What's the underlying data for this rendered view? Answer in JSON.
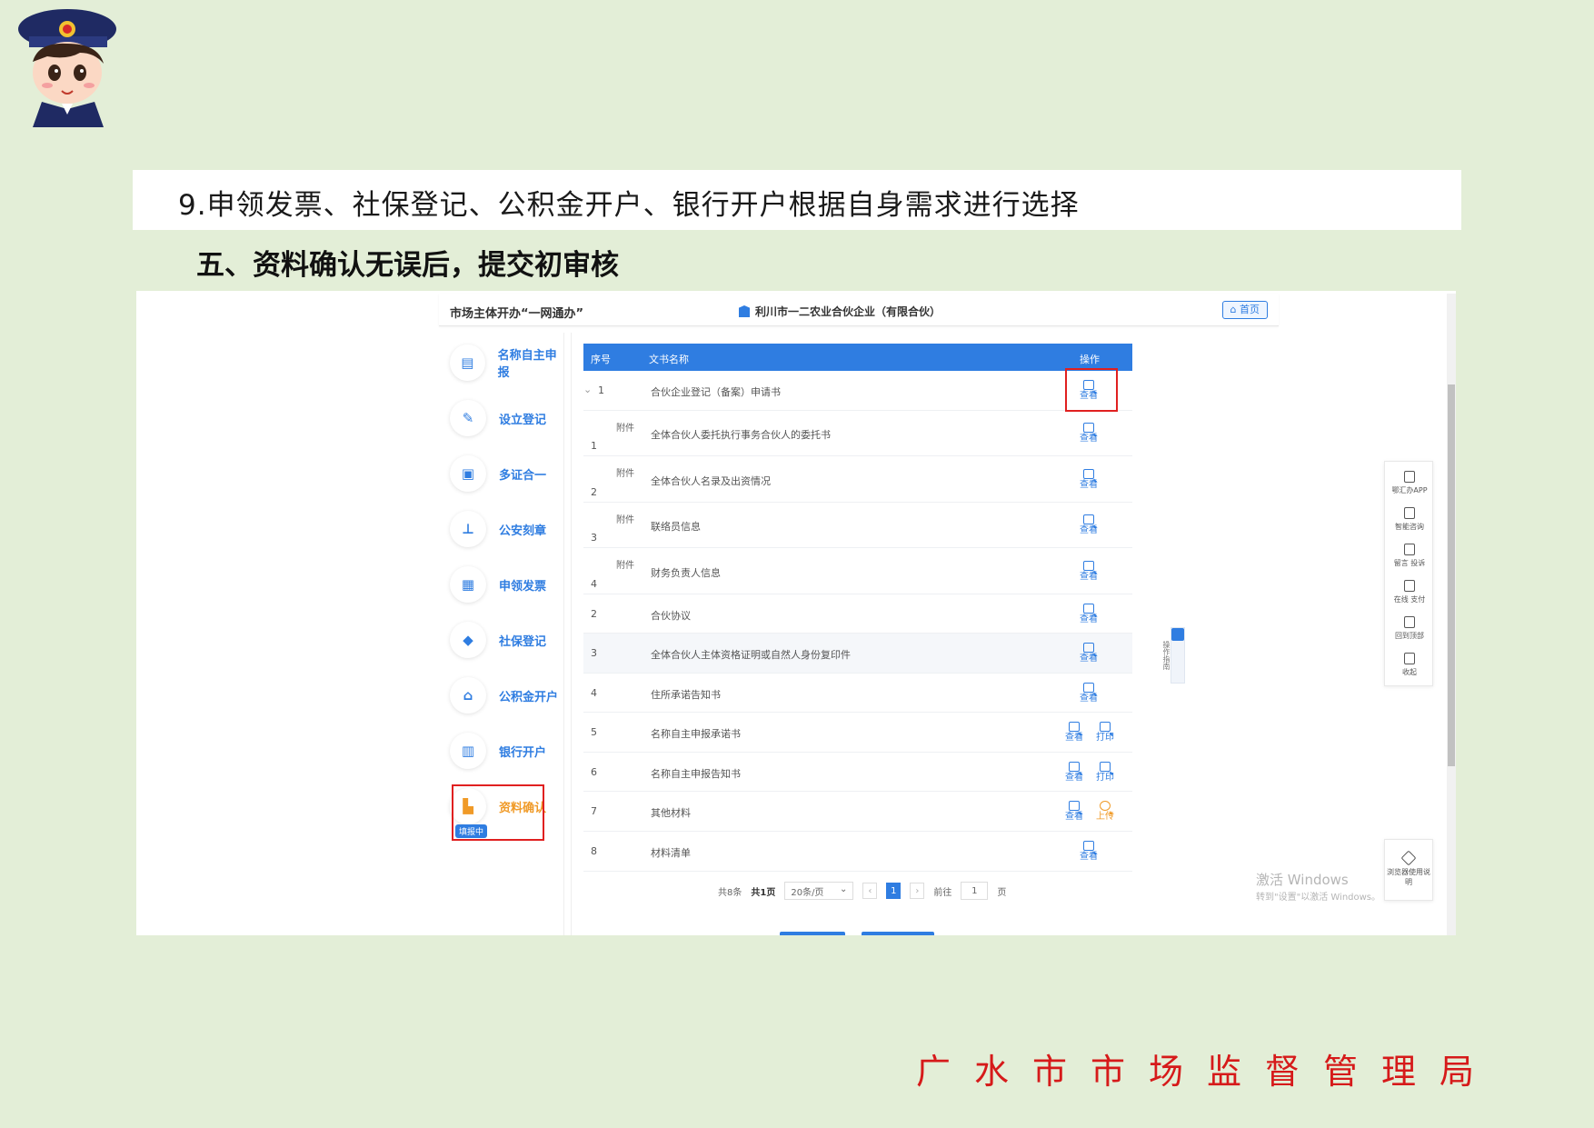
{
  "doc": {
    "step_text": "9.申领发票、社保登记、公积金开户、银行开户根据自身需求进行选择",
    "section_title": "五、资料确认无误后，提交初审核",
    "footer_org": "广水市市场监督管理局"
  },
  "app": {
    "title": "市场主体开办“一网通办”",
    "company": "利川市一二农业合伙企业（有限合伙）",
    "home_label": "首页"
  },
  "sidebar": {
    "items": [
      {
        "label": "名称自主申报",
        "icon": "doc-icon"
      },
      {
        "label": "设立登记",
        "icon": "edit-icon"
      },
      {
        "label": "多证合一",
        "icon": "id-card-icon"
      },
      {
        "label": "公安刻章",
        "icon": "stamp-icon"
      },
      {
        "label": "申领发票",
        "icon": "invoice-icon"
      },
      {
        "label": "社保登记",
        "icon": "shield-icon"
      },
      {
        "label": "公积金开户",
        "icon": "house-icon"
      },
      {
        "label": "银行开户",
        "icon": "bank-icon"
      },
      {
        "label": "资料确认",
        "icon": "file-icon"
      }
    ],
    "active_index": 8,
    "progress_badge": "填报中"
  },
  "table": {
    "headers": {
      "seq": "序号",
      "name": "文书名称",
      "ops": "操作"
    },
    "rows": [
      {
        "seq": "1",
        "expander": "⌄",
        "attach": "",
        "name": "合伙企业登记（备案）申请书",
        "ops": [
          "查看"
        ]
      },
      {
        "seq": "1",
        "attach": "附件",
        "name": "全体合伙人委托执行事务合伙人的委托书",
        "ops": [
          "查看"
        ]
      },
      {
        "seq": "2",
        "attach": "附件",
        "name": "全体合伙人名录及出资情况",
        "ops": [
          "查看"
        ]
      },
      {
        "seq": "3",
        "attach": "附件",
        "name": "联络员信息",
        "ops": [
          "查看"
        ]
      },
      {
        "seq": "4",
        "attach": "附件",
        "name": "财务负责人信息",
        "ops": [
          "查看"
        ]
      },
      {
        "seq": "2",
        "attach": "",
        "name": "合伙协议",
        "ops": [
          "查看"
        ]
      },
      {
        "seq": "3",
        "attach": "",
        "name": "全体合伙人主体资格证明或自然人身份复印件",
        "ops": [
          "查看"
        ]
      },
      {
        "seq": "4",
        "attach": "",
        "name": "住所承诺告知书",
        "ops": [
          "查看"
        ]
      },
      {
        "seq": "5",
        "attach": "",
        "name": "名称自主申报承诺书",
        "ops": [
          "查看",
          "打印"
        ]
      },
      {
        "seq": "6",
        "attach": "",
        "name": "名称自主申报告知书",
        "ops": [
          "查看",
          "打印"
        ]
      },
      {
        "seq": "7",
        "attach": "",
        "name": "其他材料",
        "ops": [
          "查看",
          "上传"
        ]
      },
      {
        "seq": "8",
        "attach": "",
        "name": "材料清单",
        "ops": [
          "查看"
        ]
      }
    ]
  },
  "pager": {
    "total": "共8条",
    "pages": "共1页",
    "page_size": "20条/页",
    "current": "1",
    "goto_prefix": "前往",
    "goto_value": "1",
    "goto_suffix": "页"
  },
  "help_tab": "操作指南",
  "toolbar": [
    {
      "label": "鄂汇办APP",
      "icon": "phone-icon"
    },
    {
      "label": "智能咨询",
      "icon": "headset-icon"
    },
    {
      "label": "留言 投诉",
      "icon": "message-icon"
    },
    {
      "label": "在线 支付",
      "icon": "yuan-icon"
    },
    {
      "label": "回到顶部",
      "icon": "top-arrow-icon"
    },
    {
      "label": "收起",
      "icon": "collapse-icon"
    }
  ],
  "browser_tip": "浏览器使用说明",
  "watermark": {
    "line1": "激活 Windows",
    "line2": "转到\"设置\"以激活 Windows。"
  },
  "colors": {
    "primary": "#2f7de1",
    "accent": "#f09a27",
    "highlight": "#e02020",
    "footer": "#d61a1a",
    "page_bg": "#e3eed7"
  }
}
